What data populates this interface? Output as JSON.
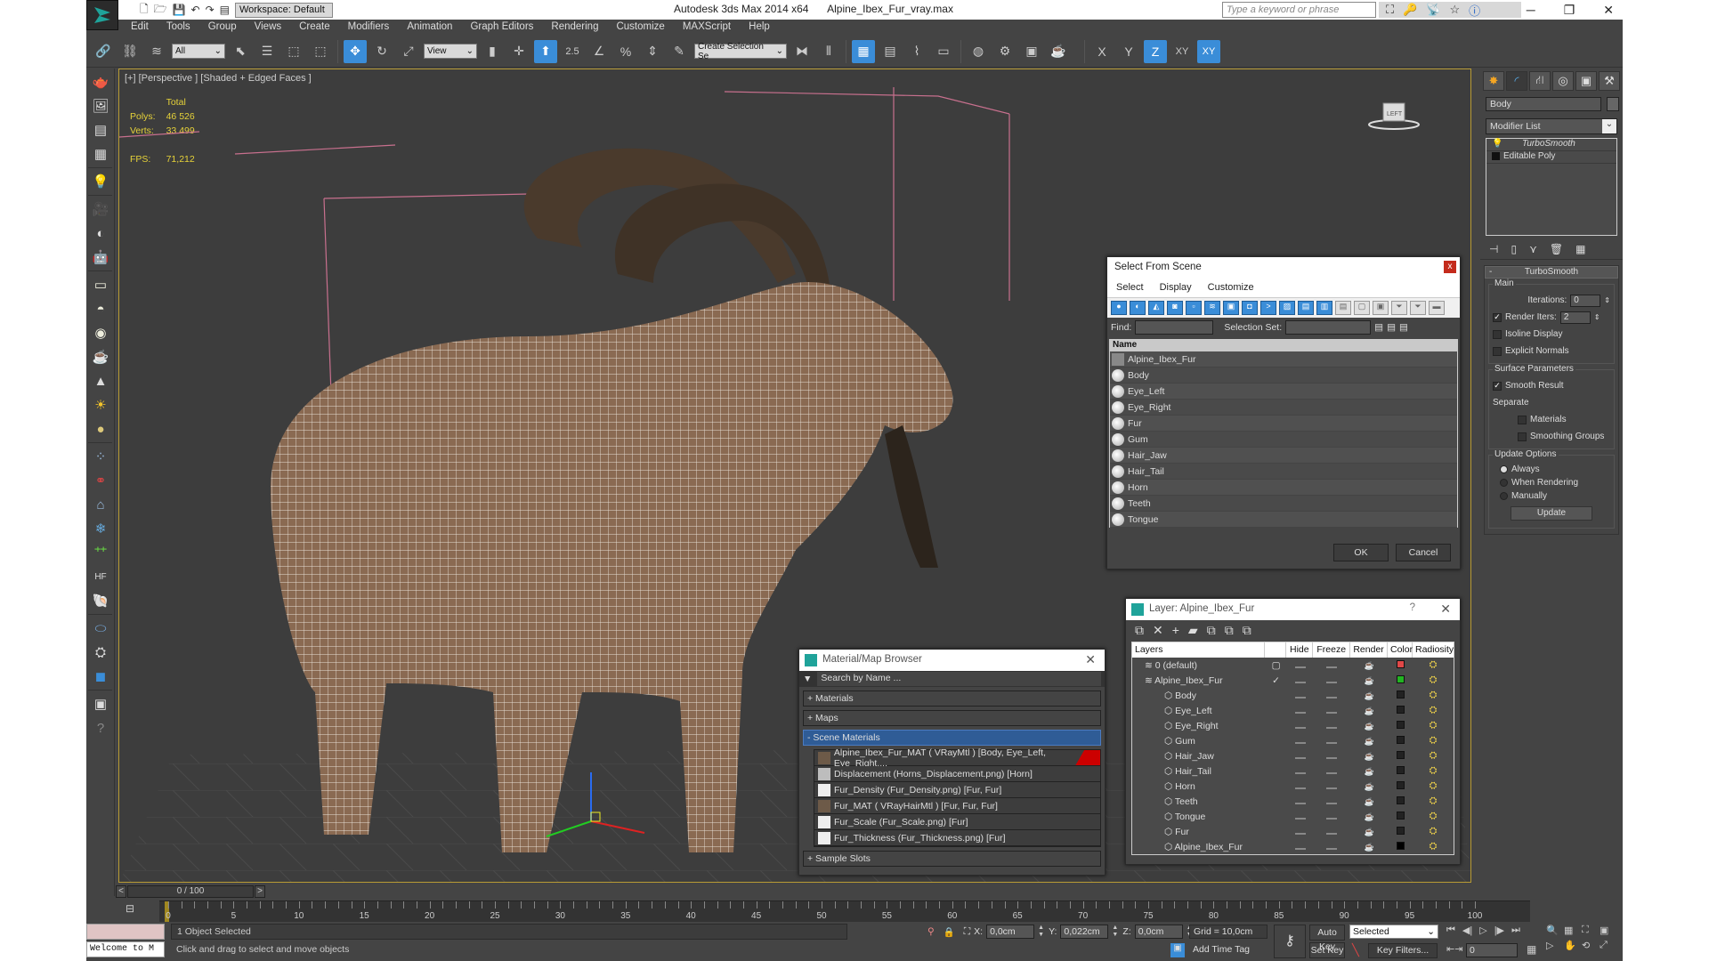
{
  "titlebar": {
    "app": "Autodesk 3ds Max  2014 x64",
    "file": "Alpine_Ibex_Fur_vray.max",
    "workspace": "Workspace: Default",
    "search_placeholder": "Type a keyword or phrase"
  },
  "menu": [
    "Edit",
    "Tools",
    "Group",
    "Views",
    "Create",
    "Modifiers",
    "Animation",
    "Graph Editors",
    "Rendering",
    "Customize",
    "MAXScript",
    "Help"
  ],
  "toolbar": {
    "selection_filter": "All",
    "ref_coord": "View",
    "snap_angle": "2.5",
    "named_selection": "Create Selection Se",
    "axis": [
      "X",
      "Y",
      "Z",
      "XY",
      "XY"
    ]
  },
  "viewport": {
    "label": "[+] [Perspective ] [Shaded + Edged Faces ]",
    "stats": {
      "total_label": "Total",
      "polys_label": "Polys:",
      "polys": "46 526",
      "verts_label": "Verts:",
      "verts": "33 499",
      "fps_label": "FPS:",
      "fps": "71,212"
    }
  },
  "command_panel": {
    "object_name": "Body",
    "modifier_list": "Modifier List",
    "stack": [
      "TurboSmooth",
      "Editable Poly"
    ],
    "rollout": "TurboSmooth",
    "main_label": "Main",
    "iterations_label": "Iterations:",
    "iterations": "0",
    "render_iters_label": "Render Iters:",
    "render_iters": "2",
    "render_iters_checked": true,
    "isoline": "Isoline Display",
    "explicit": "Explicit Normals",
    "surface_label": "Surface Parameters",
    "smooth_result": "Smooth Result",
    "separate": "Separate",
    "materials": "Materials",
    "smoothing_groups": "Smoothing Groups",
    "update_label": "Update Options",
    "always": "Always",
    "when_rendering": "When Rendering",
    "manually": "Manually",
    "update_btn": "Update"
  },
  "select_from_scene": {
    "title": "Select From Scene",
    "menu": [
      "Select",
      "Display",
      "Customize"
    ],
    "find_label": "Find:",
    "selset_label": "Selection Set:",
    "column": "Name",
    "items": [
      "Alpine_Ibex_Fur",
      "Body",
      "Eye_Left",
      "Eye_Right",
      "Fur",
      "Gum",
      "Hair_Jaw",
      "Hair_Tail",
      "Horn",
      "Teeth",
      "Tongue"
    ],
    "ok": "OK",
    "cancel": "Cancel"
  },
  "material_browser": {
    "title": "Material/Map Browser",
    "search_placeholder": "Search by Name ...",
    "sections": [
      "+ Materials",
      "+ Maps",
      "- Scene Materials",
      "+ Sample Slots"
    ],
    "items": [
      "Alpine_Ibex_Fur_MAT  ( VRayMtl )  [Body, Eye_Left, Eye_Right,...",
      "Displacement (Horns_Displacement.png) [Horn]",
      "Fur_Density (Fur_Density.png)  [Fur, Fur]",
      "Fur_MAT  ( VRayHairMtl )  [Fur, Fur, Fur]",
      "Fur_Scale (Fur_Scale.png)  [Fur]",
      "Fur_Thickness (Fur_Thickness.png)  [Fur]"
    ]
  },
  "layer_dialog": {
    "title": "Layer: Alpine_Ibex_Fur",
    "columns": [
      "Layers",
      "",
      "Hide",
      "Freeze",
      "Render",
      "Color",
      "Radiosity"
    ],
    "rows": [
      {
        "name": "0 (default)",
        "color": "#e04848",
        "level": 0
      },
      {
        "name": "Alpine_Ibex_Fur",
        "color": "#22b422",
        "level": 0,
        "current": true
      },
      {
        "name": "Body",
        "color": "#222222",
        "level": 1
      },
      {
        "name": "Eye_Left",
        "color": "#222222",
        "level": 1
      },
      {
        "name": "Eye_Right",
        "color": "#222222",
        "level": 1
      },
      {
        "name": "Gum",
        "color": "#222222",
        "level": 1
      },
      {
        "name": "Hair_Jaw",
        "color": "#222222",
        "level": 1
      },
      {
        "name": "Hair_Tail",
        "color": "#222222",
        "level": 1
      },
      {
        "name": "Horn",
        "color": "#222222",
        "level": 1
      },
      {
        "name": "Teeth",
        "color": "#222222",
        "level": 1
      },
      {
        "name": "Tongue",
        "color": "#222222",
        "level": 1
      },
      {
        "name": "Fur",
        "color": "#222222",
        "level": 1
      },
      {
        "name": "Alpine_Ibex_Fur",
        "color": "#000000",
        "level": 1
      }
    ]
  },
  "timeline": {
    "frame_display": "0 / 100",
    "ticks": [
      0,
      5,
      10,
      15,
      20,
      25,
      30,
      35,
      40,
      45,
      50,
      55,
      60,
      65,
      70,
      75,
      80,
      85,
      90,
      95,
      100
    ]
  },
  "status": {
    "welcome": "Welcome to M",
    "selected": "1 Object Selected",
    "prompt": "Click and drag to select and move objects",
    "x_label": "X:",
    "x": "0,0cm",
    "y_label": "Y:",
    "y": "0,022cm",
    "z_label": "Z:",
    "z": "0,0cm",
    "grid": "Grid = 10,0cm",
    "add_time_tag": "Add Time Tag",
    "auto_key": "Auto Key",
    "set_key": "Set Key",
    "key_mode": "Selected",
    "key_filters": "Key Filters...",
    "frame": "0"
  }
}
